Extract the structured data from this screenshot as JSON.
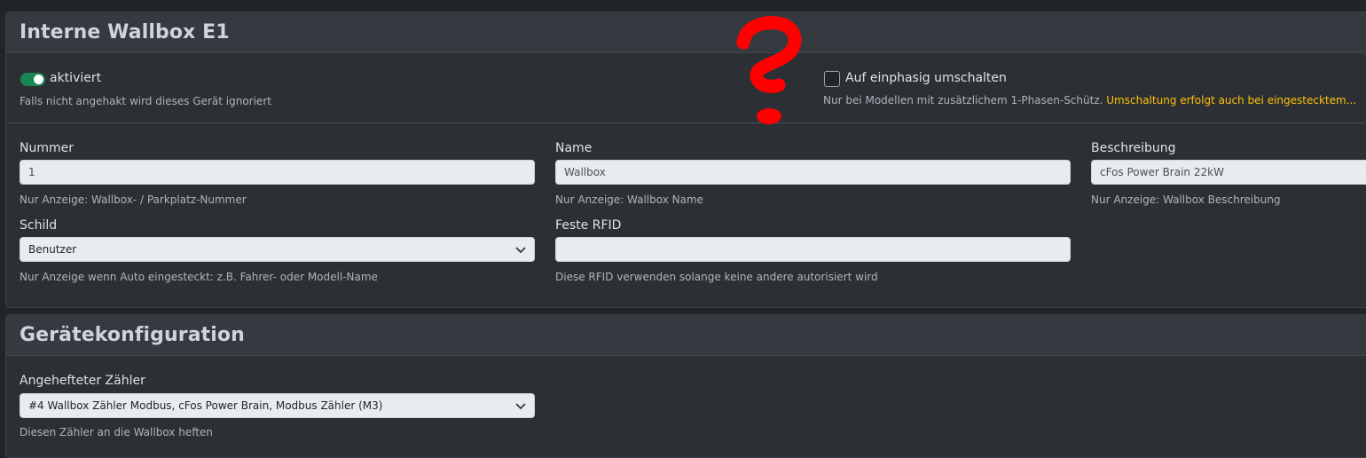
{
  "section1": {
    "title": "Interne Wallbox E1",
    "enabled": {
      "label": "aktiviert",
      "checked": true,
      "help": "Falls nicht angehakt wird dieses Gerät ignoriert"
    },
    "single_phase": {
      "label": "Auf einphasig umschalten",
      "checked": false,
      "help": "Nur bei Modellen mit zusätzlichem 1-Phasen-Schütz.",
      "warning": "Umschaltung erfolgt auch bei eingestecktem..."
    },
    "number": {
      "label": "Nummer",
      "value": "1",
      "help": "Nur Anzeige: Wallbox- / Parkplatz-Nummer"
    },
    "name": {
      "label": "Name",
      "value": "Wallbox",
      "help": "Nur Anzeige: Wallbox Name"
    },
    "description": {
      "label": "Beschreibung",
      "value": "cFos Power Brain 22kW",
      "help": "Nur Anzeige: Wallbox Beschreibung"
    },
    "sign": {
      "label": "Schild",
      "value": "Benutzer",
      "help": "Nur Anzeige wenn Auto eingesteckt: z.B. Fahrer- oder Modell-Name"
    },
    "rfid": {
      "label": "Feste RFID",
      "value": "",
      "help": "Diese RFID verwenden solange keine andere autorisiert wird"
    }
  },
  "section2": {
    "title": "Gerätekonfiguration",
    "meter": {
      "label": "Angehefteter Zähler",
      "value": "#4 Wallbox Zähler Modbus, cFos Power Brain, Modbus Zähler (M3)",
      "help": "Diesen Zähler an die Wallbox heften"
    }
  },
  "annotation": {
    "symbol": "question-mark",
    "color": "#ff0000"
  },
  "colors": {
    "toggle_on": "#198754",
    "warning": "#ffc107",
    "background": "#212529",
    "card": "#2c3034"
  }
}
